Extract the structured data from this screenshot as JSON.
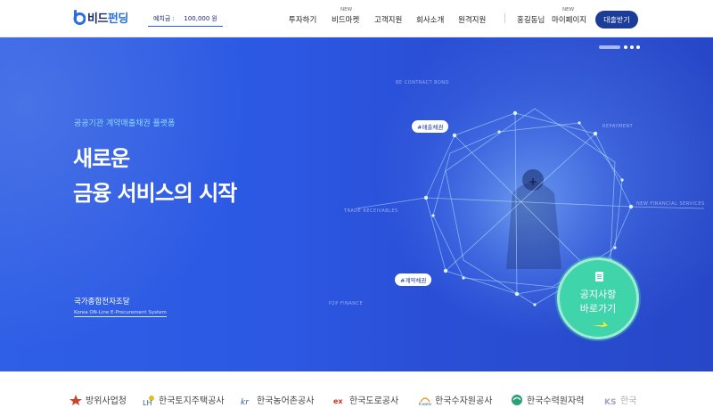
{
  "header": {
    "logo_text_a": "비드",
    "logo_text_b": "펀딩",
    "deposit_label": "예치금 :",
    "deposit_amount": "100,000 원",
    "nav": [
      {
        "label": "투자하기",
        "new": ""
      },
      {
        "label": "비드마켓",
        "new": "NEW"
      },
      {
        "label": "고객지원",
        "new": ""
      },
      {
        "label": "회사소개",
        "new": ""
      },
      {
        "label": "원격지원",
        "new": ""
      }
    ],
    "user_name": "홍길동님",
    "mypage_label": "마이페이지",
    "mypage_new": "NEW",
    "cta_label": "대출받기"
  },
  "hero": {
    "subtitle": "공공기관 계약매출채권 플랫폼",
    "title_line1": "새로운",
    "title_line2": "금융 서비스의 시작",
    "org": "국가종합전자조달",
    "org_en": "Korea ON-Line E-Procurement System",
    "tags": [
      "#매출채권",
      "#계약채권"
    ],
    "network_labels": [
      "BE CONTRACT BOND",
      "REPAYMENT",
      "NEW FINANCIAL SERVICES",
      "TRADE RECEIVABLES",
      "P2P FINANCE"
    ]
  },
  "notice": {
    "line1": "공지사항",
    "line2": "바로가기",
    "icon": "document-icon"
  },
  "partners": [
    "방위사업청",
    "한국토지주택공사",
    "한국농어촌공사",
    "한국도로공사",
    "한국수자원공사",
    "한국수력원자력",
    "한국"
  ],
  "colors": {
    "brand_navy": "#1c3c9a",
    "hero_blue": "#2c58e3",
    "notice_green": "#3fd4a9",
    "subtitle_cyan": "#8fd8ff"
  }
}
